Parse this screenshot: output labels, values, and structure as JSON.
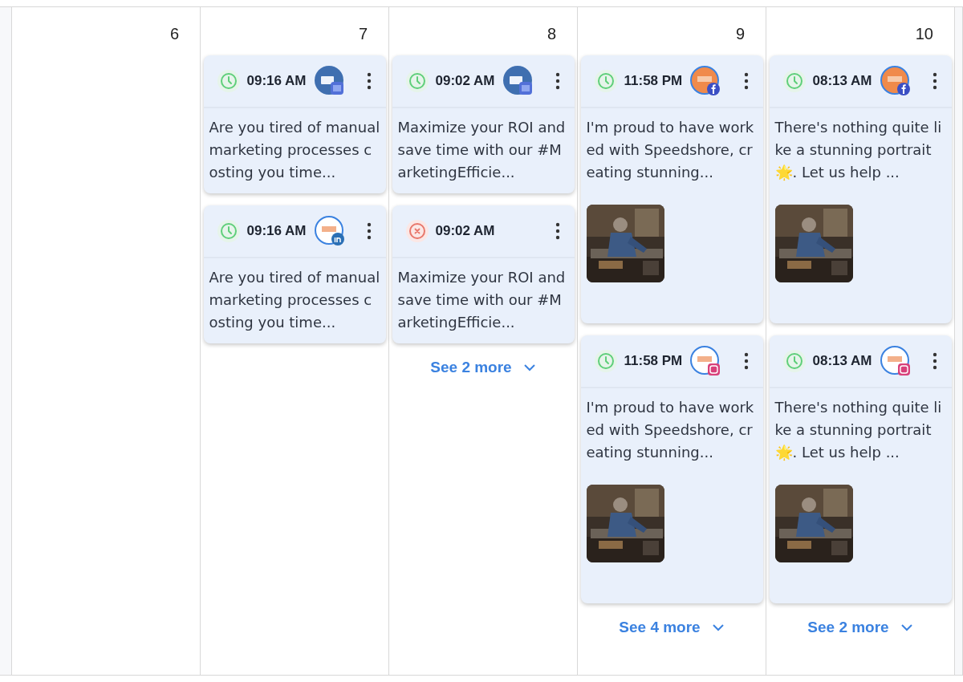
{
  "days": [
    {
      "number": "6"
    },
    {
      "number": "7",
      "posts": [
        {
          "kind": "scheduled",
          "time": "09:16 AM",
          "avatar": {
            "kind": "business"
          },
          "text": "Are you tired of manual marketing processes costing you time...",
          "image": false
        },
        {
          "kind": "scheduled",
          "time": "09:16 AM",
          "avatar": {
            "kind": "linkedin"
          },
          "text": "Are you tired of manual marketing processes costing you time...",
          "image": false
        }
      ]
    },
    {
      "number": "8",
      "posts": [
        {
          "kind": "scheduled",
          "time": "09:02 AM",
          "avatar": {
            "kind": "business"
          },
          "text": "Maximize your ROI and save time with our #MarketingEfficie...",
          "image": false
        },
        {
          "kind": "failed",
          "time": "09:02 AM",
          "text": "Maximize your ROI and save time with our #MarketingEfficie...",
          "image": false
        }
      ],
      "see_more": "See 2 more"
    },
    {
      "number": "9",
      "posts": [
        {
          "kind": "scheduled",
          "time": "11:58 PM",
          "avatar": {
            "kind": "facebook"
          },
          "text": "I'm proud to have worked with Speedshore, creating stunning...",
          "image": true
        },
        {
          "kind": "scheduled",
          "time": "11:58 PM",
          "avatar": {
            "kind": "instagram"
          },
          "text": "I'm proud to have worked with Speedshore, creating stunning...",
          "image": true
        }
      ],
      "see_more": "See 4 more"
    },
    {
      "number": "10",
      "posts": [
        {
          "kind": "scheduled",
          "time": "08:13 AM",
          "avatar": {
            "kind": "facebook"
          },
          "text": "There's nothing quite like a stunning portrait 🌟. Let us help ...",
          "image": true
        },
        {
          "kind": "scheduled",
          "time": "08:13 AM",
          "avatar": {
            "kind": "instagram"
          },
          "text": "There's nothing quite like a stunning portrait 🌟. Let us help ...",
          "image": true
        }
      ],
      "see_more": "See 2 more"
    }
  ]
}
